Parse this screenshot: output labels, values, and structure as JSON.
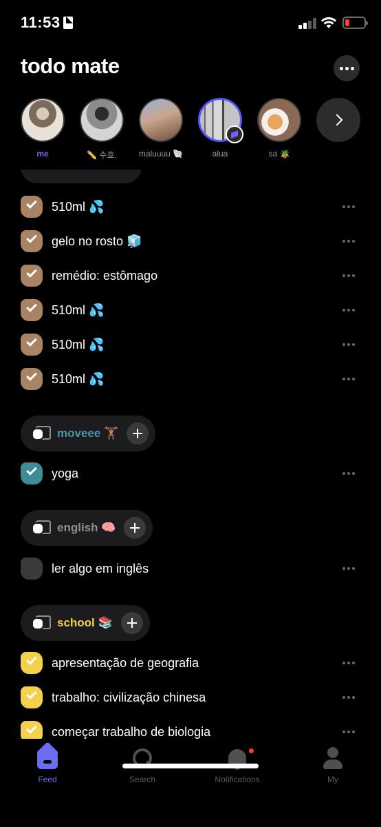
{
  "status_bar": {
    "time": "11:53",
    "battery_color": "#ff3b30"
  },
  "header": {
    "title": "todo mate",
    "more_icon": "ellipsis-icon"
  },
  "friends": [
    {
      "name": "me",
      "selected": true
    },
    {
      "name": "✏️ 수호."
    },
    {
      "name": "maluuuu 🐚"
    },
    {
      "name": "alua"
    },
    {
      "name": "sa 🪴"
    }
  ],
  "categories": {
    "moveee": {
      "label": "moveee 🏋🏾",
      "color": "#4a97a3"
    },
    "english": {
      "label": "english 🧠",
      "color": "#8e8e93"
    },
    "school": {
      "label": "school 📚",
      "color": "#f4d14a"
    }
  },
  "todos": {
    "water1": {
      "text": "510ml 💦",
      "done": true
    },
    "ice": {
      "text": "gelo no rosto 🧊",
      "done": true
    },
    "medicine": {
      "text": "remédio: estômago",
      "done": true
    },
    "water2": {
      "text": "510ml 💦",
      "done": true
    },
    "water3": {
      "text": "510ml 💦",
      "done": true
    },
    "water4": {
      "text": "510ml 💦",
      "done": true
    },
    "yoga": {
      "text": "yoga",
      "done": true
    },
    "read": {
      "text": "ler algo em inglês",
      "done": false
    },
    "geo": {
      "text": "apresentação de geografia",
      "done": true
    },
    "china": {
      "text": "trabalho: civilização chinesa",
      "done": true
    },
    "bio": {
      "text": "começar trabalho de biologia",
      "done": true
    }
  },
  "tabs": [
    {
      "label": "Feed",
      "active": true
    },
    {
      "label": "Search"
    },
    {
      "label": "Notifications"
    },
    {
      "label": "My"
    }
  ],
  "accent_color": "#6e6cf0"
}
